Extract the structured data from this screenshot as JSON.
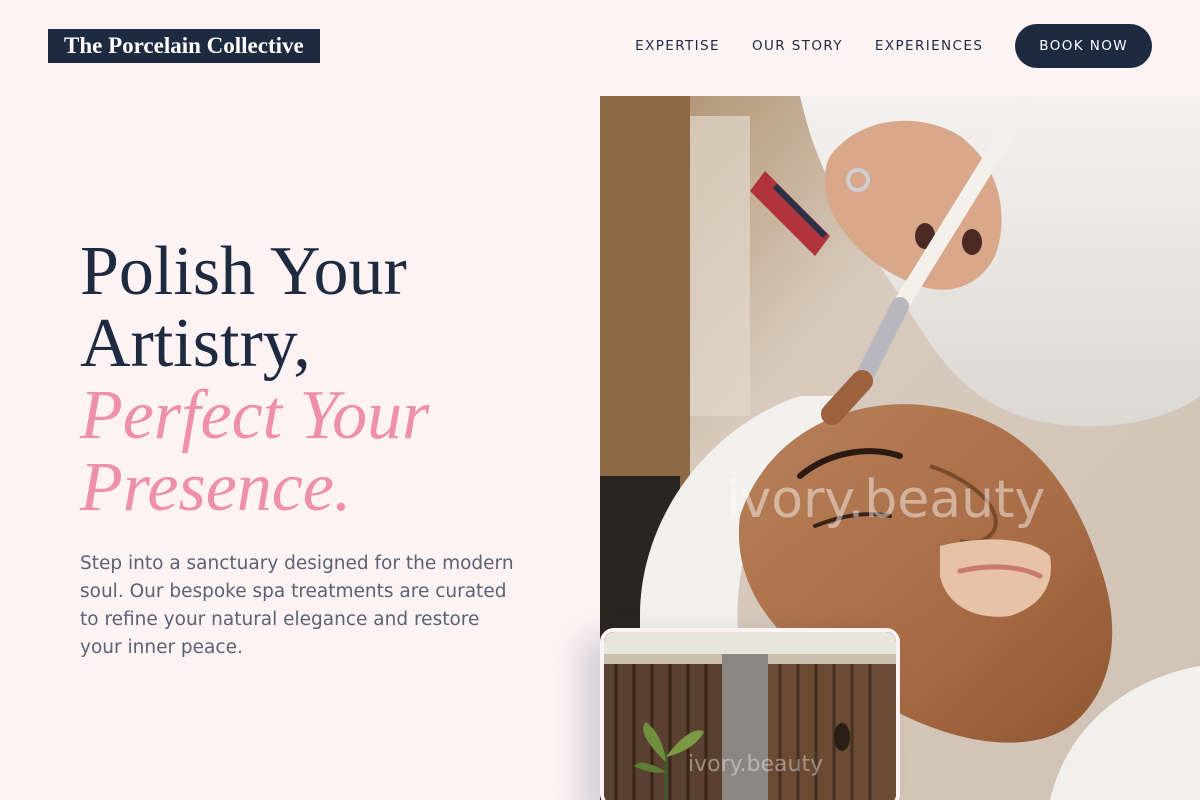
{
  "brand": {
    "name": "The Porcelain Collective"
  },
  "nav": {
    "items": [
      {
        "label": "EXPERTISE"
      },
      {
        "label": "OUR STORY"
      },
      {
        "label": "EXPERIENCES"
      }
    ],
    "cta_label": "BOOK NOW"
  },
  "hero": {
    "title_lines": [
      "Polish Your",
      "Artistry,"
    ],
    "accent_lines": [
      "Perfect Your",
      "Presence."
    ],
    "body": "Step into a sanctuary designed for the modern soul. Our bespoke spa treatments are curated to refine your natural elegance and restore your inner peace."
  },
  "images": {
    "main_watermark": "ivory.beauty",
    "inset_watermark": "ivory.beauty"
  },
  "colors": {
    "background": "#fdf2f4",
    "navy": "#1e2a40",
    "accent_pink": "#ee8fae",
    "body_text": "#5b6272"
  }
}
